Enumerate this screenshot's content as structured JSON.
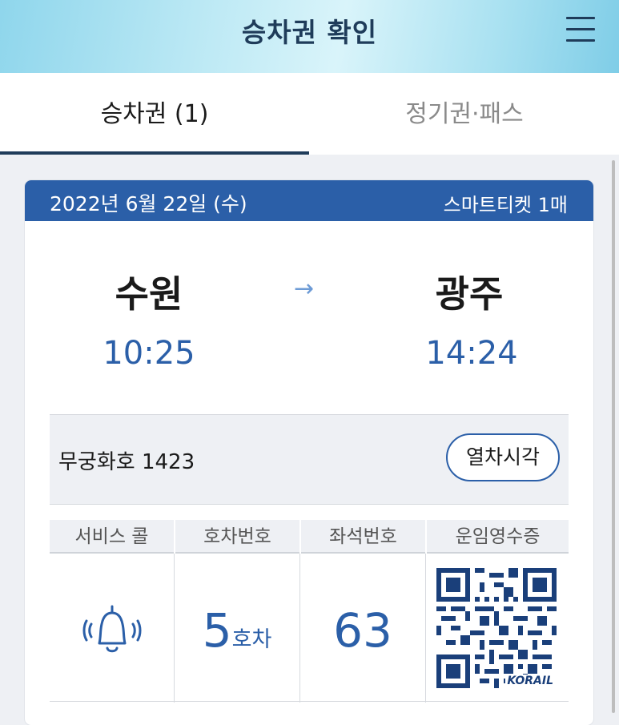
{
  "header": {
    "title": "승차권 확인",
    "menu_icon": "hamburger-menu-icon"
  },
  "tabs": [
    {
      "label": "승차권 (1)",
      "active": true
    },
    {
      "label": "정기권·패스",
      "active": false
    }
  ],
  "ticket": {
    "date": "2022년 6월 22일 (수)",
    "ticket_type": "스마트티켓 1매",
    "departure": {
      "station": "수원",
      "time": "10:25"
    },
    "arrival": {
      "station": "광주",
      "time": "14:24"
    },
    "arrow": "→",
    "train": "무궁화호 1423",
    "schedule_button": "열차시각",
    "columns": [
      "서비스 콜",
      "호차번호",
      "좌석번호",
      "운임영수증"
    ],
    "car_number": "5",
    "car_unit": "호차",
    "seat_number": "63",
    "qr_label": "KORAIL"
  },
  "colors": {
    "brand_blue": "#2b5fa8",
    "header_text": "#1f3c5a",
    "arrow": "#6d9bd6"
  }
}
